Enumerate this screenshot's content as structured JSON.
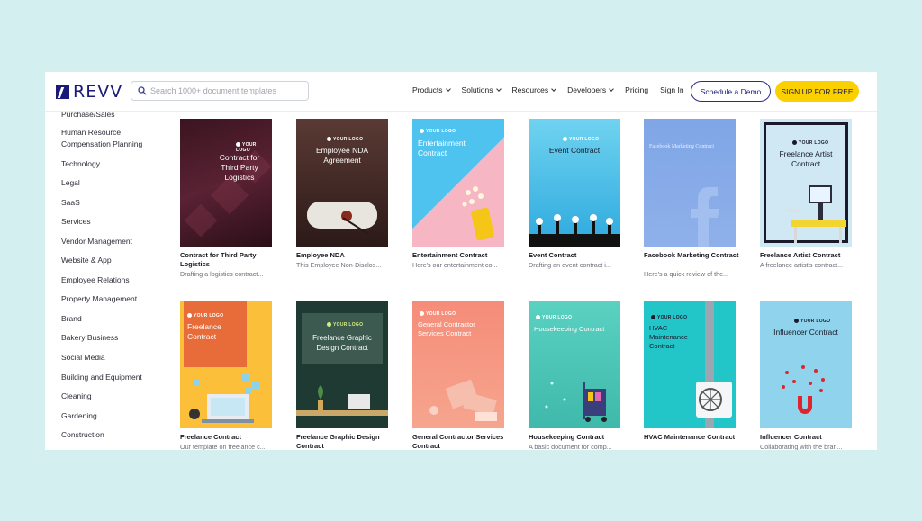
{
  "header": {
    "brand": "REVV",
    "search_placeholder": "Search 1000+ document templates",
    "nav": [
      "Products",
      "Solutions",
      "Resources",
      "Developers"
    ],
    "pricing": "Pricing",
    "signin": "Sign In",
    "demo_button": "Schedule a Demo",
    "signup_button": "SIGN UP FOR FREE"
  },
  "sidebar": {
    "items": [
      "Purchase/Sales",
      "Human Resource",
      "Compensation Planning",
      "Technology",
      "Legal",
      "SaaS",
      "Services",
      "Vendor Management",
      "Website & App",
      "Employee Relations",
      "Property Management",
      "Brand",
      "Bakery Business",
      "Social Media",
      "Building and Equipment",
      "Cleaning",
      "Gardening",
      "Construction"
    ]
  },
  "cards": [
    {
      "title": "Contract for Third Party Logistics",
      "desc": "Drafting a logistics contract...",
      "thumb_logo": "YOUR LOGO",
      "thumb_title": "Contract for Third Party Logistics"
    },
    {
      "title": "Employee NDA",
      "desc": "This Employee Non-Disclos...",
      "thumb_logo": "YOUR LOGO",
      "thumb_title": "Employee NDA Agreement"
    },
    {
      "title": "Entertainment Contract",
      "desc": "Here's our entertainment co...",
      "thumb_logo": "YOUR LOGO",
      "thumb_title": "Entertainment Contract"
    },
    {
      "title": "Event Contract",
      "desc": "Drafting an event contract i...",
      "thumb_logo": "YOUR LOGO",
      "thumb_title": "Event Contract"
    },
    {
      "title": "Facebook Marketing Contract",
      "desc": "Here's a quick review of the...",
      "thumb_logo": "",
      "thumb_title": "Facebook Marketing Contract"
    },
    {
      "title": "Freelance Artist Contract",
      "desc": "A freelance artist's contract...",
      "thumb_logo": "YOUR LOGO",
      "thumb_title": "Freelance Artist Contract"
    },
    {
      "title": "Freelance Contract",
      "desc": "Our template on freelance c...",
      "thumb_logo": "YOUR LOGO",
      "thumb_title": "Freelance Contract"
    },
    {
      "title": "Freelance Graphic Design Contract",
      "desc": "",
      "thumb_logo": "YOUR LOGO",
      "thumb_title": "Freelance Graphic Design Contract"
    },
    {
      "title": "General Contractor Services Contract",
      "desc": "",
      "thumb_logo": "YOUR LOGO",
      "thumb_title": "General Contractor Services Contract"
    },
    {
      "title": "Housekeeping Contract",
      "desc": "A basic document for comp...",
      "thumb_logo": "YOUR LOGO",
      "thumb_title": "Housekeeping Contract"
    },
    {
      "title": "HVAC Maintenance Contract",
      "desc": "",
      "thumb_logo": "YOUR LOGO",
      "thumb_title": "HVAC Maintenance Contract"
    },
    {
      "title": "Influencer Contract",
      "desc": "Collaborating with the bran...",
      "thumb_logo": "YOUR LOGO",
      "thumb_title": "Influencer Contract"
    }
  ]
}
